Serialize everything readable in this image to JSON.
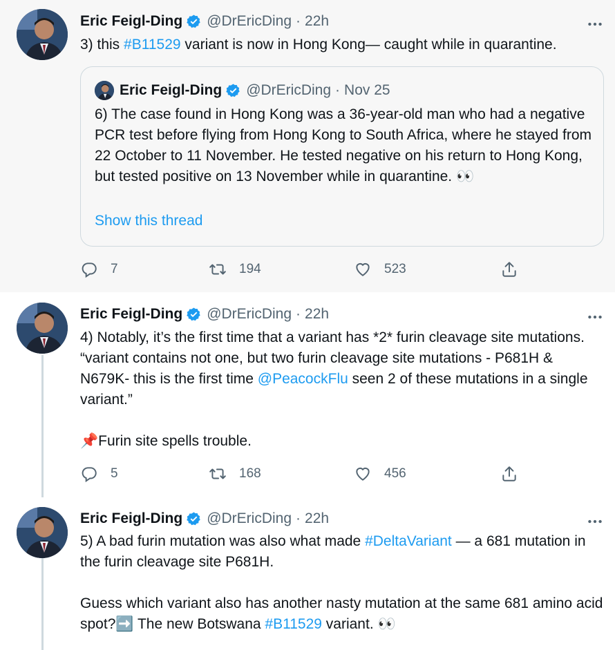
{
  "tweets": [
    {
      "author_name": "Eric Feigl-Ding",
      "handle": "@DrEricDing",
      "dot": "·",
      "time": "22h",
      "text_parts": [
        "3) this ",
        "#B11529",
        " variant is now in Hong Kong— caught while in quarantine."
      ],
      "quote": {
        "author_name": "Eric Feigl-Ding",
        "handle": "@DrEricDing",
        "dot": "·",
        "time": "Nov 25",
        "text": "6) The case found in Hong Kong was a 36-year-old man who had a negative PCR test before flying from Hong Kong to South Africa, where he stayed from 22 October to 11 November. He tested negative on his return to Hong Kong, but tested positive on 13 November while in quarantine. 👀",
        "show_thread": "Show this thread"
      },
      "replies": "7",
      "retweets": "194",
      "likes": "523"
    },
    {
      "author_name": "Eric Feigl-Ding",
      "handle": "@DrEricDing",
      "dot": "·",
      "time": "22h",
      "text_a": "4) Notably, it’s the first time that a variant has *2* furin cleavage site mutations. “variant contains not one, but two furin cleavage site mutations - P681H & N679K- this is the first time ",
      "mention": "@PeacockFlu",
      "text_b": " seen 2 of these mutations in a single variant.”",
      "text_c": "📌Furin site spells trouble.",
      "replies": "5",
      "retweets": "168",
      "likes": "456"
    },
    {
      "author_name": "Eric Feigl-Ding",
      "handle": "@DrEricDing",
      "dot": "·",
      "time": "22h",
      "text_a1": "5) A bad furin mutation was also what made ",
      "hashtag1": "#DeltaVariant",
      "text_a2": " — a 681 mutation in the furin cleavage site P681H.",
      "text_b1": "Guess which variant also has another nasty mutation at the same 681 amino acid spot?➡️ The new Botswana ",
      "hashtag2": "#B11529",
      "text_b2": " variant. 👀"
    }
  ],
  "colors": {
    "link": "#1d9bf0",
    "muted": "#536471",
    "border": "#cfd9de",
    "verified": "#1d9bf0"
  }
}
